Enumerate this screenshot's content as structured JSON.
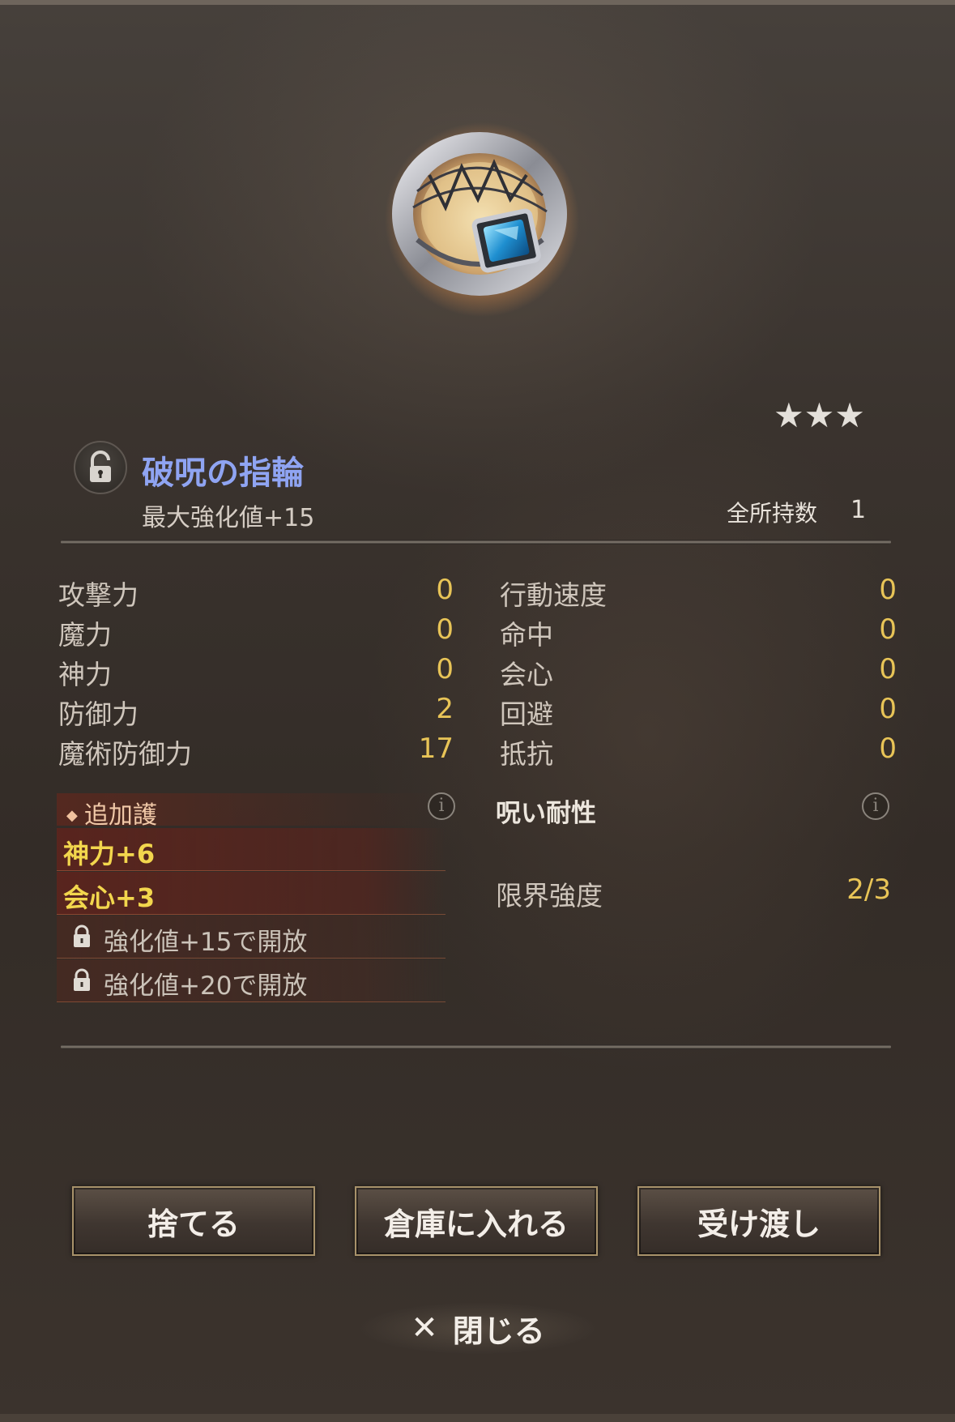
{
  "item": {
    "rarity_stars": "★★★",
    "name": "破呪の指輪",
    "max_enhancement": "最大強化値+15",
    "owned_label": "全所持数",
    "owned_value": "1",
    "name_color": "#8fa4f2"
  },
  "stats_left": [
    {
      "label": "攻撃力",
      "value": "0"
    },
    {
      "label": "魔力",
      "value": "0"
    },
    {
      "label": "神力",
      "value": "0"
    },
    {
      "label": "防御力",
      "value": "2"
    },
    {
      "label": "魔術防御力",
      "value": "17"
    }
  ],
  "stats_right": [
    {
      "label": "行動速度",
      "value": "0"
    },
    {
      "label": "命中",
      "value": "0"
    },
    {
      "label": "会心",
      "value": "0"
    },
    {
      "label": "回避",
      "value": "0"
    },
    {
      "label": "抵抗",
      "value": "0"
    }
  ],
  "extra_protection": {
    "title": "追加護",
    "info_icon": "i",
    "bonuses": [
      "神力+6",
      "会心+3"
    ],
    "locked": [
      "強化値+15で開放",
      "強化値+20で開放"
    ]
  },
  "curse_resistance": {
    "title": "呪い耐性",
    "info_icon": "i"
  },
  "limit_strength": {
    "label": "限界強度",
    "value": "2/3"
  },
  "buttons": {
    "discard": "捨てる",
    "store": "倉庫に入れる",
    "transfer": "受け渡し"
  },
  "close": {
    "icon": "✕",
    "label": "閉じる"
  },
  "colors": {
    "stat_value": "#e8c457",
    "bonus_text": "#f2d64d",
    "button_border": "#a8926a"
  }
}
